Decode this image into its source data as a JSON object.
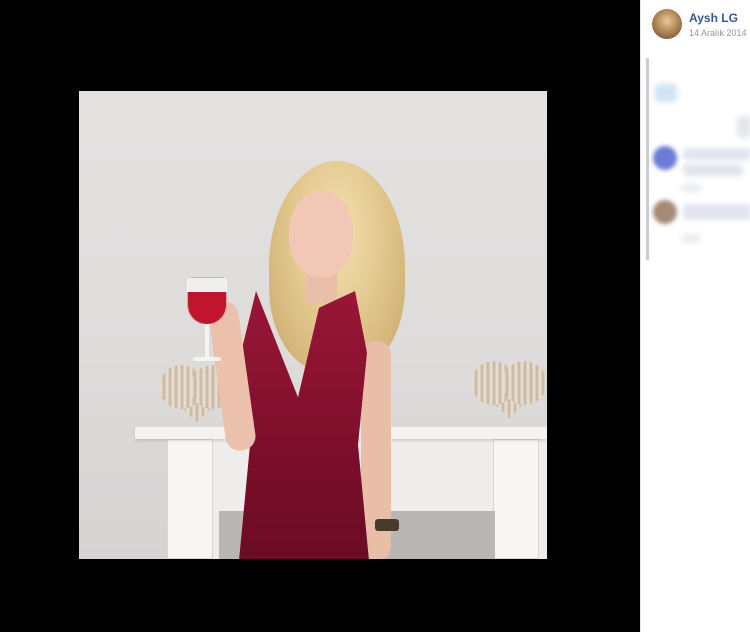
{
  "post": {
    "author_name": "Aysh LG",
    "date": "14 Aralık 2014"
  },
  "colors": {
    "theater_background": "#000000",
    "author_link": "#365899",
    "meta_text": "#90949c"
  },
  "icons": {
    "author_avatar": "profile-photo"
  }
}
